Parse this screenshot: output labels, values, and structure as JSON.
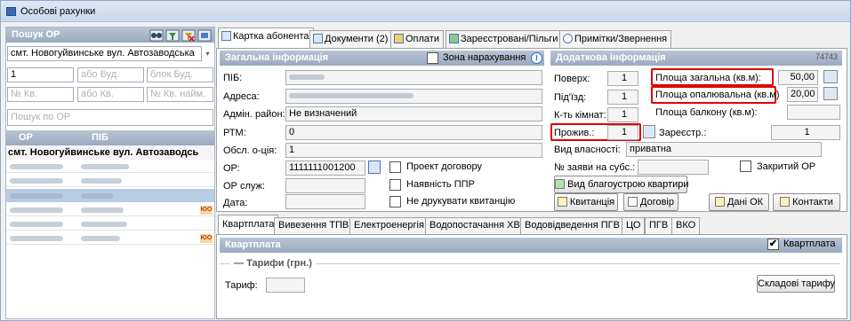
{
  "window": {
    "title": "Особові рахунки"
  },
  "search": {
    "header": "Пошук ОР",
    "street_value": "смт. Новогуйвинське вул. Автозаводська",
    "house_value": "1",
    "bud_placeholder": "або Буд.",
    "block_placeholder": "блок Буд.",
    "kv_placeholder": "№ Кв.",
    "kv_alt_placeholder": "або Кв.",
    "naim_placeholder": "№ Кв. найм.",
    "search_placeholder": "Пошук по ОР"
  },
  "list": {
    "col_or": "ОР",
    "col_pib": "ПІБ",
    "group_title": "смт. Новогуйвинське вул. Автозаводсь",
    "badge": "ЮО"
  },
  "tabs": [
    {
      "label": "Картка абонента"
    },
    {
      "label": "Документи (2)"
    },
    {
      "label": "Оплати"
    },
    {
      "label": "Зареєстровані/Пільги"
    },
    {
      "label": "Примітки/Звернення"
    }
  ],
  "general": {
    "header": "Загальна інформація",
    "zone_label": "Зона нарахування",
    "pib_label": "ПІБ:",
    "address_label": "Адреса:",
    "district_label": "Адмін. район:",
    "district_value": "Не визначений",
    "rtm_label": "РТМ:",
    "rtm_value": "0",
    "obsl_label": "Обсл. о-ція:",
    "obsl_value": "1",
    "or_label": "ОР:",
    "or_value": "1111111001200",
    "or_sluzh_label": "ОР служ:",
    "date_label": "Дата:",
    "project_label": "Проект договору",
    "ppr_label": "Наявність ППР",
    "noprint_label": "Не друкувати квитанцію"
  },
  "extra": {
    "header": "Додаткова інформація",
    "code": "74743",
    "floor_label": "Поверх:",
    "floor_value": "1",
    "entrance_label": "Під'їзд:",
    "entrance_value": "1",
    "rooms_label": "К-ть кімнат:",
    "rooms_value": "1",
    "living_label": "Прожив.:",
    "living_value": "1",
    "total_area_label": "Площа загальна (кв.м):",
    "total_area_value": "50,00",
    "heated_area_label": "Площа опалювальна (кв.м)",
    "heated_area_value": "20,00",
    "balcony_label": "Площа балкону (кв.м):",
    "registered_label": "Зареєстр.:",
    "registered_value": "1",
    "ownership_label": "Вид власності:",
    "ownership_value": "приватна",
    "subsidy_label": "№ заяви на субс.:",
    "closed_label": "Закритий ОР",
    "improvement_button": "Вид благоустрою квартири",
    "receipt_button": "Квитанція",
    "contract_button": "Договір",
    "ok_data_button": "Дані ОК",
    "contacts_button": "Контакти"
  },
  "bottom_tabs": [
    {
      "label": "Квартплата"
    },
    {
      "label": "Вивезення ТПВ"
    },
    {
      "label": "Електроенергія"
    },
    {
      "label": "Водопостачання ХВ"
    },
    {
      "label": "Водовідведення ПГВ"
    },
    {
      "label": "ЦО"
    },
    {
      "label": "ПГВ"
    },
    {
      "label": "ВКО"
    }
  ],
  "rent": {
    "header": "Квартплата",
    "checkbox_label": "Квартплата",
    "tariffs_legend": "Тарифи (грн.)",
    "tariff_label": "Тариф:",
    "components_button": "Складові тарифу"
  },
  "colors": {
    "accent": "#b8cce4",
    "highlight": "#e00000",
    "badge": "#f6d8a0"
  }
}
